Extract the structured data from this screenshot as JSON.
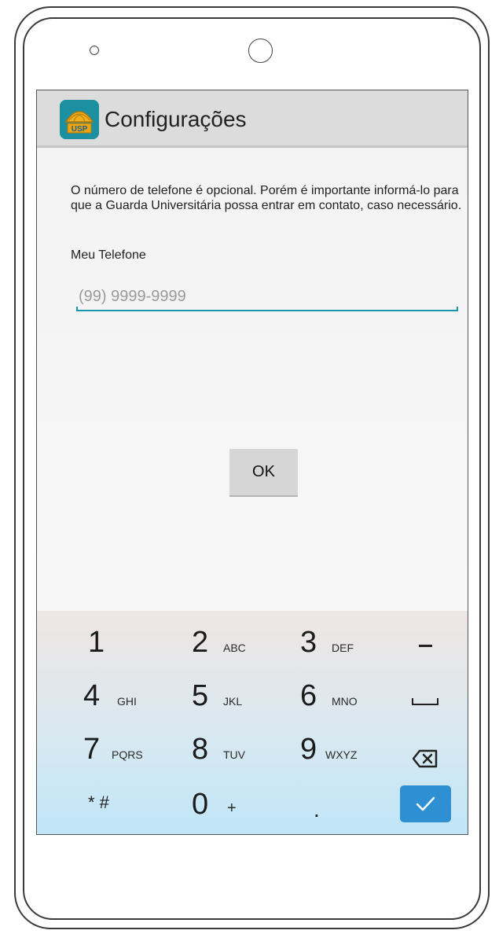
{
  "app": {
    "title": "Configurações",
    "icon_name": "usp-app-icon",
    "icon_text": "USP"
  },
  "content": {
    "intro_text": "O número de telefone é opcional. Porém é importante informá-lo para que a Guarda Universitária possa entrar em contato, caso necessário.",
    "phone_label": "Meu Telefone",
    "phone_placeholder": "(99) 9999-9999",
    "phone_value": "",
    "ok_label": "OK"
  },
  "keyboard": {
    "rows": [
      [
        {
          "main": "1",
          "sub": ""
        },
        {
          "main": "2",
          "sub": "ABC"
        },
        {
          "main": "3",
          "sub": "DEF"
        },
        {
          "main": "−",
          "sub": "",
          "icon": "minus-icon"
        }
      ],
      [
        {
          "main": "4",
          "sub": "GHI"
        },
        {
          "main": "5",
          "sub": "JKL"
        },
        {
          "main": "6",
          "sub": "MNO"
        },
        {
          "main": "",
          "sub": "",
          "icon": "space-icon"
        }
      ],
      [
        {
          "main": "7",
          "sub": "PQRS"
        },
        {
          "main": "8",
          "sub": "TUV"
        },
        {
          "main": "9",
          "sub": "WXYZ"
        },
        {
          "main": "",
          "sub": "",
          "icon": "backspace-icon"
        }
      ],
      [
        {
          "main": "* #",
          "sub": ""
        },
        {
          "main": "0",
          "sub": "+"
        },
        {
          "main": ".",
          "sub": ""
        },
        {
          "main": "",
          "sub": "",
          "icon": "checkmark-icon"
        }
      ]
    ],
    "key_1": "1",
    "key_2": "2",
    "key_2_sub": "ABC",
    "key_3": "3",
    "key_3_sub": "DEF",
    "key_4": "4",
    "key_4_sub": "GHI",
    "key_5": "5",
    "key_5_sub": "JKL",
    "key_6": "6",
    "key_6_sub": "MNO",
    "key_7": "7",
    "key_7_sub": "PQRS",
    "key_8": "8",
    "key_8_sub": "TUV",
    "key_9": "9",
    "key_9_sub": "WXYZ",
    "key_star_hash": "* #",
    "key_0": "0",
    "key_0_sub": "+",
    "key_dot": ".",
    "done_color": "#2e8fd2"
  },
  "colors": {
    "accent": "#1994ab",
    "action_bar": "#dcdcdc"
  }
}
